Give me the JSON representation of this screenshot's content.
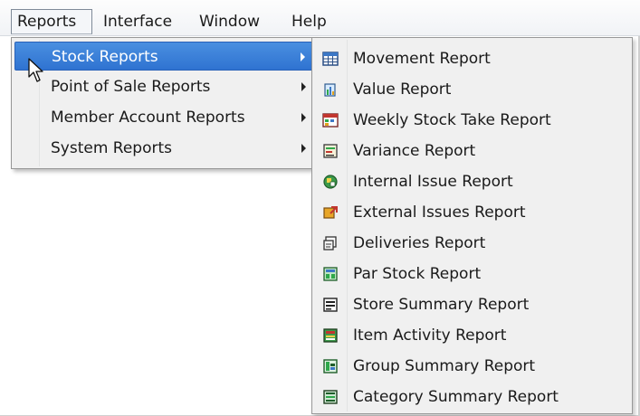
{
  "menubar": {
    "items": [
      {
        "label": "Reports"
      },
      {
        "label": "Interface"
      },
      {
        "label": "Window"
      },
      {
        "label": "Help"
      }
    ]
  },
  "reports_menu": {
    "items": [
      {
        "label": "Stock Reports"
      },
      {
        "label": "Point of Sale Reports"
      },
      {
        "label": "Member Account Reports"
      },
      {
        "label": "System Reports"
      }
    ]
  },
  "stock_reports_submenu": {
    "items": [
      {
        "label": "Movement Report",
        "icon": "calendar-grid-icon"
      },
      {
        "label": "Value Report",
        "icon": "value-chart-icon"
      },
      {
        "label": "Weekly Stock Take Report",
        "icon": "weekly-stock-take-icon"
      },
      {
        "label": "Variance Report",
        "icon": "variance-icon"
      },
      {
        "label": "Internal Issue Report",
        "icon": "internal-issue-icon"
      },
      {
        "label": "External Issues Report",
        "icon": "external-issue-icon"
      },
      {
        "label": "Deliveries Report",
        "icon": "deliveries-icon"
      },
      {
        "label": "Par Stock Report",
        "icon": "par-stock-icon"
      },
      {
        "label": "Store Summary Report",
        "icon": "store-summary-icon"
      },
      {
        "label": "Item Activity Report",
        "icon": "item-activity-icon"
      },
      {
        "label": "Group Summary Report",
        "icon": "group-summary-icon"
      },
      {
        "label": "Category Summary Report",
        "icon": "category-summary-icon"
      }
    ]
  },
  "colors": {
    "highlight": "#3a7fd8",
    "menu_background": "#f0f0f0"
  }
}
